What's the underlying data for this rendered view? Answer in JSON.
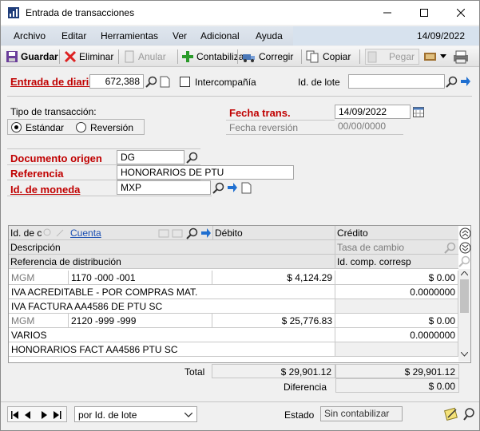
{
  "window": {
    "title": "Entrada de transacciones",
    "app_icon": "chart-app-icon"
  },
  "menu": {
    "items": [
      "Archivo",
      "Editar",
      "Herramientas",
      "Ver",
      "Adicional",
      "Ayuda"
    ],
    "date": "14/09/2022"
  },
  "toolbar": {
    "save": "Guardar",
    "delete": "Eliminar",
    "void": "Anular",
    "post": "Contabiliza",
    "correct": "Corregir",
    "copy": "Copiar",
    "post_disabled": "Pegar"
  },
  "header": {
    "journal_entry_label": "Entrada de diario",
    "journal_entry_value": "672,388",
    "intercompany_label": "Intercompañía",
    "batch_id_label": "Id. de lote",
    "batch_id_value": "",
    "transaction_type_label": "Tipo de transacción:",
    "type_standard": "Estándar",
    "type_reversal": "Reversión",
    "trx_date_label": "Fecha trans.",
    "trx_date_value": "14/09/2022",
    "reversal_date_label": "Fecha reversión",
    "reversal_date_value": "00/00/0000",
    "source_doc_label": "Documento origen",
    "source_doc_value": "DG",
    "reference_label": "Referencia",
    "reference_value": "HONORARIOS DE PTU",
    "currency_label": "Id. de moneda",
    "currency_value": "MXP"
  },
  "grid": {
    "h1": {
      "co_id": "Id. de cc",
      "account": "Cuenta",
      "debit": "Débito",
      "credit": "Crédito"
    },
    "h2": {
      "description": "Descripción",
      "exchange_rate": "Tasa de cambio"
    },
    "h3": {
      "dist_ref": "Referencia de distribución",
      "corr_co": "Id. comp. corresp"
    },
    "rows": [
      {
        "co": "MGM",
        "account": "1170 -000 -001",
        "debit": "$ 4,124.29",
        "credit": "$ 0.00",
        "description": "IVA ACREDITABLE - POR COMPRAS MAT.",
        "rate": "0.0000000",
        "dist_ref": "IVA FACTURA AA4586 DE PTU SC",
        "corr": ""
      },
      {
        "co": "MGM",
        "account": "2120 -999 -999",
        "debit": "$ 25,776.83",
        "credit": "$ 0.00",
        "description": "VARIOS",
        "rate": "0.0000000",
        "dist_ref": "HONORARIOS FACT AA4586 PTU SC",
        "corr": ""
      }
    ]
  },
  "totals": {
    "total_label": "Total",
    "total_debit": "$ 29,901.12",
    "total_credit": "$ 29,901.12",
    "diff_label": "Diferencia",
    "diff_value": "$ 0.00"
  },
  "status": {
    "sort_select": "por Id. de lote",
    "state_label": "Estado",
    "state_value": "Sin contabilizar"
  }
}
